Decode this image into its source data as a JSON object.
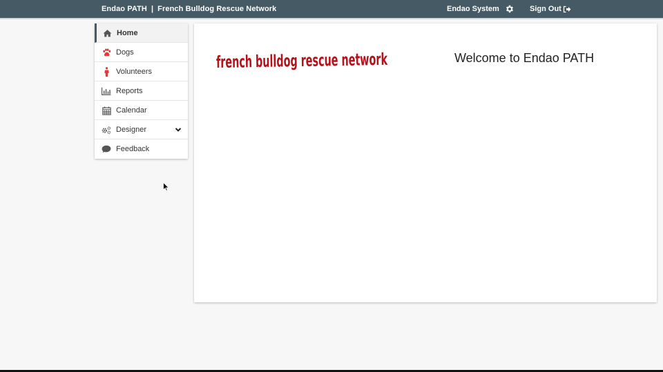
{
  "header": {
    "app_name": "Endao PATH",
    "separator": "|",
    "org_name": "French Bulldog Rescue Network",
    "system_label": "Endao System",
    "settings_icon": "gear-icon",
    "signout_label": "Sign Out",
    "signout_icon": "sign-out-icon",
    "bg_color": "#455a64"
  },
  "sidebar": {
    "items": [
      {
        "label": "Home",
        "icon": "home-icon",
        "active": true
      },
      {
        "label": "Dogs",
        "icon": "paw-icon",
        "color": "#e53935"
      },
      {
        "label": "Volunteers",
        "icon": "person-icon",
        "color": "#e53935"
      },
      {
        "label": "Reports",
        "icon": "bar-chart-icon"
      },
      {
        "label": "Calendar",
        "icon": "calendar-icon"
      },
      {
        "label": "Designer",
        "icon": "cogs-icon",
        "has_dropdown": true
      },
      {
        "label": "Feedback",
        "icon": "comment-icon"
      }
    ]
  },
  "main": {
    "logo_text": "french bulldog rescue network",
    "logo_color": "#b5121b",
    "welcome_text": "Welcome to Endao PATH"
  }
}
